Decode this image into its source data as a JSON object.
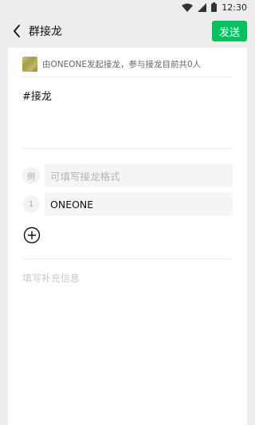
{
  "status_bar": {
    "time": "12:30",
    "icons": [
      "wifi-icon",
      "signal-icon",
      "battery-icon"
    ]
  },
  "nav": {
    "back_icon": "chevron-left-icon",
    "title": "群接龙",
    "send_label": "发送",
    "send_color": "#07c160"
  },
  "initiator": {
    "text": "由ONEONE发起接龙，参与接龙目前共0人"
  },
  "topic": {
    "text": "#接龙"
  },
  "entries": [
    {
      "index": "例",
      "placeholder": "可填写接龙格式",
      "value": ""
    },
    {
      "index": "1",
      "placeholder": "",
      "value": "ONEONE"
    }
  ],
  "add_icon": "add-circle-icon",
  "extra_info": {
    "placeholder": "填写补充信息"
  }
}
